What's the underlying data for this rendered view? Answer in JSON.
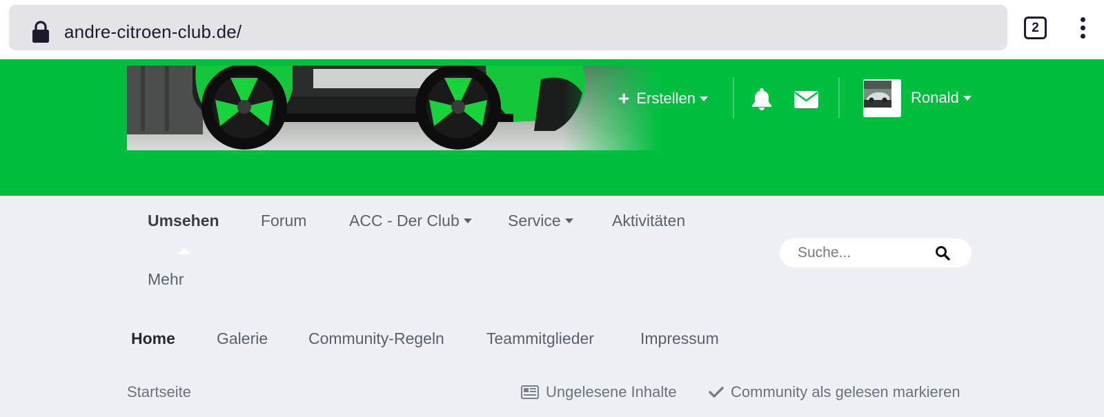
{
  "browser": {
    "url": "andre-citroen-club.de/",
    "tab_count": "2"
  },
  "header": {
    "create_label": "Erstellen",
    "user_name": "Ronald"
  },
  "nav": {
    "items": [
      {
        "label": "Umsehen",
        "active": true
      },
      {
        "label": "Forum"
      },
      {
        "label": "ACC - Der Club",
        "dropdown": true
      },
      {
        "label": "Service",
        "dropdown": true
      },
      {
        "label": "Aktivitäten"
      },
      {
        "label": "Mehr"
      }
    ],
    "search_placeholder": "Suche..."
  },
  "subnav": {
    "items": [
      {
        "label": "Home",
        "active": true
      },
      {
        "label": "Galerie"
      },
      {
        "label": "Community-Regeln"
      },
      {
        "label": "Teammitglieder"
      },
      {
        "label": "Impressum"
      }
    ]
  },
  "breadcrumb": {
    "label": "Startseite"
  },
  "actions": {
    "unread": "Ungelesene Inhalte",
    "mark_read": "Community als gelesen markieren"
  },
  "colors": {
    "header_green": "#00bf3f",
    "page_bg": "#edf0f5"
  }
}
